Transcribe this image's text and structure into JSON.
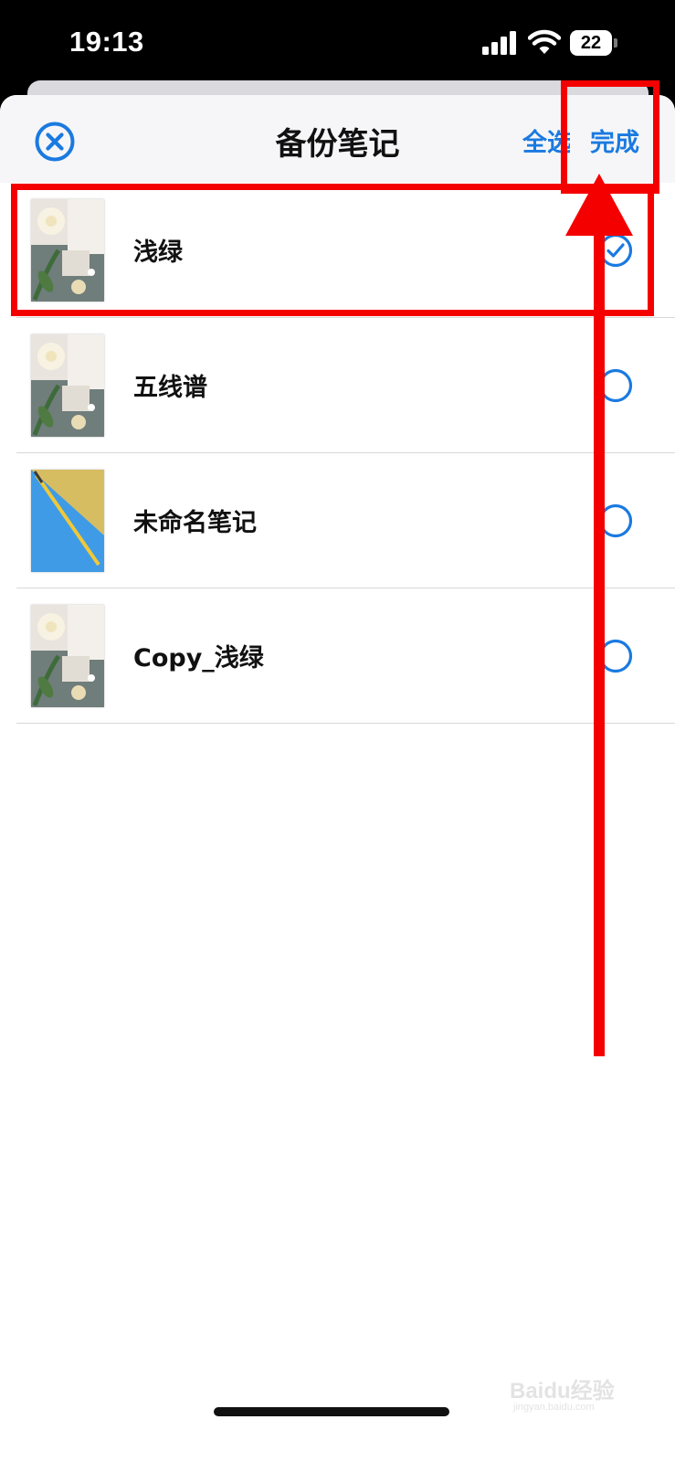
{
  "status_bar": {
    "time": "19:13",
    "battery": "22",
    "icons": [
      "cellular-signal-icon",
      "wifi-icon",
      "battery-icon"
    ]
  },
  "sheet": {
    "title": "备份笔记",
    "close_icon": "close-circle-icon",
    "select_all_label": "全选",
    "done_label": "完成"
  },
  "notes": [
    {
      "name": "浅绿",
      "thumbnail": "flower-stationery",
      "selected": true
    },
    {
      "name": "五线谱",
      "thumbnail": "flower-stationery",
      "selected": false
    },
    {
      "name": "未命名笔记",
      "thumbnail": "pencil-yellow-blue",
      "selected": false
    },
    {
      "name": "Copy_浅绿",
      "thumbnail": "flower-stationery",
      "selected": false
    }
  ],
  "colors": {
    "accent": "#1a7ae0",
    "annotation": "#f40000",
    "header_bg": "#f6f6f8"
  },
  "watermark": {
    "text": "Baidu经验",
    "sub": "jingyan.baidu.com"
  }
}
